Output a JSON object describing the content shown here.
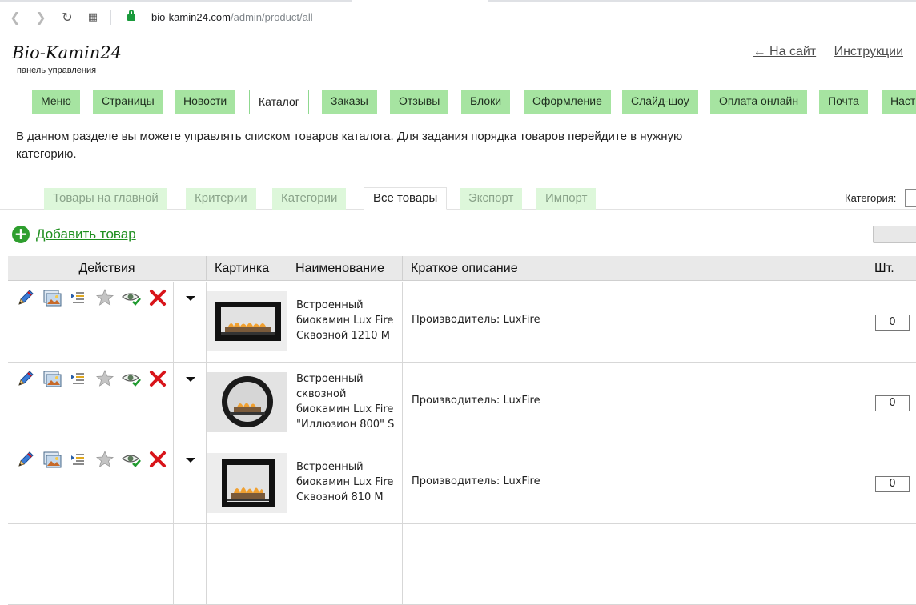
{
  "browser": {
    "url_domain": "bio-kamin24.com",
    "url_path": "/admin/product/all",
    "back_icon": "arrow-left-icon",
    "forward_icon": "arrow-right-icon",
    "reload_icon": "reload-icon",
    "apps_icon": "apps-grid-icon",
    "lock_icon": "lock-icon"
  },
  "header": {
    "brand": "Bio-Kamin24",
    "subtitle": "панель управления",
    "links": [
      "← На сайт",
      "Инструкции"
    ]
  },
  "main_tabs": [
    {
      "label": "Меню"
    },
    {
      "label": "Страницы"
    },
    {
      "label": "Новости"
    },
    {
      "label": "Каталог",
      "active": true
    },
    {
      "label": "Заказы"
    },
    {
      "label": "Отзывы"
    },
    {
      "label": "Блоки"
    },
    {
      "label": "Оформление"
    },
    {
      "label": "Слайд-шоу"
    },
    {
      "label": "Оплата онлайн"
    },
    {
      "label": "Почта"
    },
    {
      "label": "Настр"
    }
  ],
  "description": "В данном разделе вы можете управлять списком товаров каталога. Для задания порядка товаров перейдите в нужную категорию.",
  "sub_tabs": [
    {
      "label": "Товары на главной"
    },
    {
      "label": "Критерии"
    },
    {
      "label": "Категории"
    },
    {
      "label": "Все товары",
      "active": true
    },
    {
      "label": "Экспорт"
    },
    {
      "label": "Импорт"
    }
  ],
  "category": {
    "label": "Категория:",
    "value": "--"
  },
  "add_product": {
    "label": "Добавить товар",
    "icon": "plus-circle-icon"
  },
  "table": {
    "headers": [
      "Действия",
      "Картинка",
      "Наименование",
      "Краткое описание",
      "Шт."
    ],
    "action_icons": [
      "edit-pencil-icon",
      "image-icon",
      "list-indent-icon",
      "star-icon",
      "visibility-eye-icon",
      "delete-x-icon"
    ],
    "rows": [
      {
        "name": "Встроенный биокамин Lux Fire Сквозной 1210 М",
        "short": "Производитель: LuxFire",
        "qty": "0",
        "thumb": "rect-double"
      },
      {
        "name": "Встроенный сквозной биокамин Lux Fire \"Иллюзион 800\" S",
        "short": "Производитель: LuxFire",
        "qty": "0",
        "thumb": "round"
      },
      {
        "name": "Встроенный биокамин Lux Fire Сквозной 810 М",
        "short": "Производитель: LuxFire",
        "qty": "0",
        "thumb": "rect-tall"
      }
    ]
  },
  "colors": {
    "tab_green": "#a6e4a1",
    "subtab_green": "#ddf7da",
    "link_green": "#1f8f1f",
    "delete_red": "#d8141a"
  }
}
